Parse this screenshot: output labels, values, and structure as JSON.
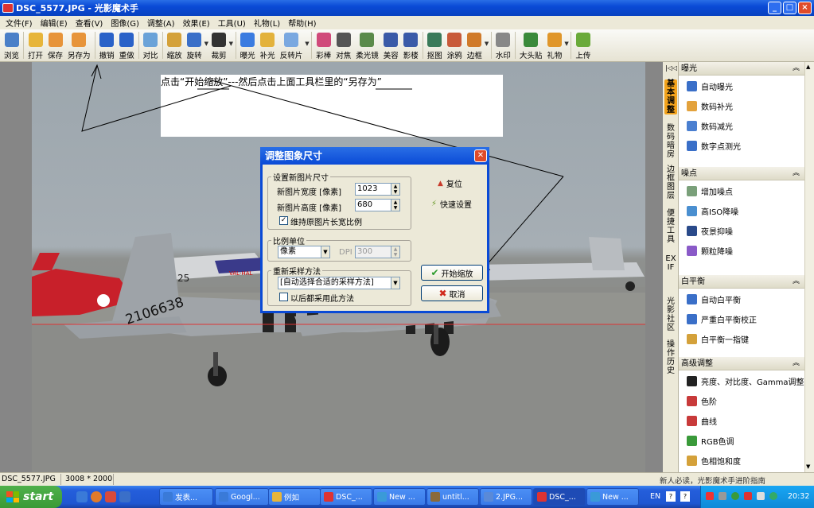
{
  "window": {
    "title": "DSC_5577.JPG - 光影魔术手",
    "btn_min": "_",
    "btn_max": "□",
    "btn_close": "×"
  },
  "menu": [
    "文件(F)",
    "编辑(E)",
    "查看(V)",
    "图像(G)",
    "调整(A)",
    "效果(E)",
    "工具(U)",
    "礼物(L)",
    "帮助(H)"
  ],
  "toolbar": [
    {
      "label": "浏览",
      "icon": "browse-icon",
      "color": "#4a7fc8"
    },
    {
      "label": "打开",
      "icon": "folder-icon",
      "color": "#e7b53a"
    },
    {
      "label": "保存",
      "icon": "save-icon",
      "color": "#e7943a"
    },
    {
      "label": "另存为",
      "icon": "save-as-icon",
      "color": "#e7943a"
    },
    {
      "label": "撤销",
      "icon": "undo-icon",
      "color": "#2a62c8"
    },
    {
      "label": "重做",
      "icon": "redo-icon",
      "color": "#2a62c8"
    },
    {
      "label": "对比",
      "icon": "compare-icon",
      "color": "#6aa2d8"
    },
    {
      "label": "缩放",
      "icon": "resize-icon",
      "color": "#d4a13a"
    },
    {
      "label": "旋转",
      "icon": "rotate-icon",
      "color": "#3a6fc8"
    },
    {
      "label": "裁剪",
      "icon": "crop-icon",
      "color": "#333333"
    },
    {
      "label": "曝光",
      "icon": "exposure-icon",
      "color": "#3a7be0"
    },
    {
      "label": "补光",
      "icon": "fill-light-icon",
      "color": "#e3b23c"
    },
    {
      "label": "反转片",
      "icon": "film-icon",
      "color": "#7aa8e0"
    },
    {
      "label": "彩棒",
      "icon": "color-wand-icon",
      "color": "#d04a7a"
    },
    {
      "label": "对焦",
      "icon": "focus-icon",
      "color": "#555555"
    },
    {
      "label": "柔光镜",
      "icon": "soft-light-icon",
      "color": "#5a8a4a"
    },
    {
      "label": "美容",
      "icon": "beauty-icon",
      "color": "#3a5aa8"
    },
    {
      "label": "影楼",
      "icon": "studio-icon",
      "color": "#3a5aa8"
    },
    {
      "label": "抠图",
      "icon": "cutout-icon",
      "color": "#3a7a5a"
    },
    {
      "label": "涂鸦",
      "icon": "doodle-icon",
      "color": "#c85a3a"
    },
    {
      "label": "边框",
      "icon": "frame-icon",
      "color": "#d07a2a"
    },
    {
      "label": "水印",
      "icon": "watermark-icon",
      "color": "#888888"
    },
    {
      "label": "大头贴",
      "icon": "sticker-icon",
      "color": "#3a8a3a"
    },
    {
      "label": "礼物",
      "icon": "gift-icon",
      "color": "#e0962a"
    },
    {
      "label": "上传",
      "icon": "upload-icon",
      "color": "#6aaa3a"
    }
  ],
  "note": "点击“开始缩放”---然后点击上面工具栏里的“另存为”",
  "dialog": {
    "title": "调整图象尺寸",
    "group_size": "设置新图片尺寸",
    "width_label": "新图片宽度 [像素]",
    "width_value": "1023",
    "height_label": "新图片高度 [像素]",
    "height_value": "680",
    "keep_ratio": "维持原图片长宽比例",
    "reset": "复位",
    "quick_set": "快速设置",
    "group_unit": "比例单位",
    "unit_value": "像素",
    "dpi_label": "DPI",
    "dpi_value": "300",
    "group_resample": "重新采样方法",
    "resample_value": "[自动选择合适的采样方法]",
    "use_always": "以后都采用此方法",
    "start": "开始缩放",
    "cancel": "取消"
  },
  "photo": {
    "tail_number": "2106638",
    "nose_number": "25",
    "label_val": "VAL-HAL"
  },
  "vtabs": [
    "基本调整",
    "数码暗房",
    "边框图层",
    "便捷工具",
    "EXIF",
    "光影社区",
    "操作历史"
  ],
  "panel": [
    {
      "title": "曝光",
      "items": [
        {
          "label": "自动曝光",
          "icon": "sun-icon",
          "color": "#3a6fc8"
        },
        {
          "label": "数码补光",
          "icon": "fill-icon",
          "color": "#e3a23c"
        },
        {
          "label": "数码减光",
          "icon": "dim-icon",
          "color": "#4a7fd0"
        },
        {
          "label": "数字点测光",
          "icon": "spot-meter-icon",
          "color": "#3a6fc8"
        }
      ]
    },
    {
      "title": "噪点",
      "items": [
        {
          "label": "增加噪点",
          "icon": "noise-add-icon",
          "color": "#7aa07a"
        },
        {
          "label": "高ISO降噪",
          "icon": "iso-icon",
          "color": "#4a8fd0"
        },
        {
          "label": "夜景抑噪",
          "icon": "night-icon",
          "color": "#2a4a8a"
        },
        {
          "label": "颗粒降噪",
          "icon": "grain-icon",
          "color": "#8a5ac8"
        }
      ]
    },
    {
      "title": "白平衡",
      "items": [
        {
          "label": "自动白平衡",
          "icon": "awb-icon",
          "color": "#3a6fc8"
        },
        {
          "label": "严重白平衡校正",
          "icon": "wb-correct-icon",
          "color": "#3a6fc8"
        },
        {
          "label": "白平衡一指键",
          "icon": "wb-picker-icon",
          "color": "#d4a13a"
        }
      ]
    },
    {
      "title": "高级调整",
      "items": [
        {
          "label": "亮度、对比度、Gamma调整",
          "icon": "brightness-icon",
          "color": "#222222"
        },
        {
          "label": "色阶",
          "icon": "levels-icon",
          "color": "#c83a3a"
        },
        {
          "label": "曲线",
          "icon": "curves-icon",
          "color": "#c83a3a"
        },
        {
          "label": "RGB色调",
          "icon": "rgb-icon",
          "color": "#3a9a3a"
        },
        {
          "label": "色相饱和度",
          "icon": "hue-icon",
          "color": "#d4a13a"
        }
      ]
    }
  ],
  "status": {
    "filename": "DSC_5577.JPG",
    "size": "3008 * 2000",
    "tip": "新人必读，光影魔术手进阶指南"
  },
  "taskbar": {
    "start": "start",
    "tasks": [
      "发表...",
      "Googl...",
      "例如",
      "DSC_...",
      "New ...",
      "untitl...",
      "2.JPG...",
      "DSC_...",
      "New ..."
    ],
    "lang": "EN",
    "time": "20:32"
  }
}
